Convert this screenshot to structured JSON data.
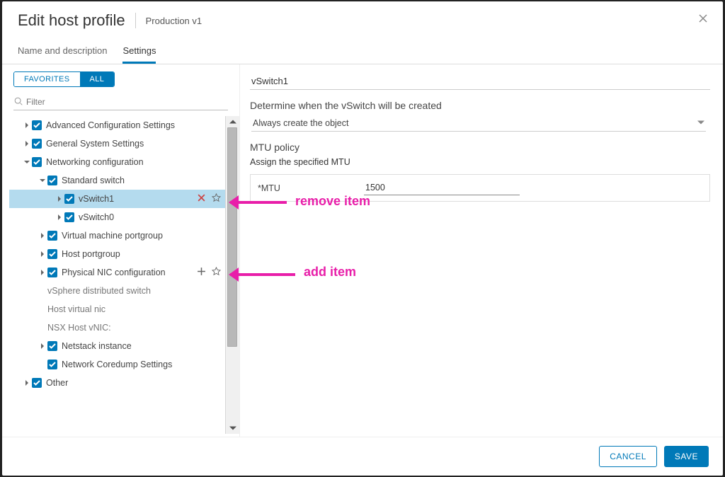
{
  "header": {
    "title": "Edit host profile",
    "subtitle": "Production v1"
  },
  "tabs": {
    "name_desc": "Name and description",
    "settings": "Settings"
  },
  "favtabs": {
    "fav": "FAVORITES",
    "all": "ALL"
  },
  "search": {
    "placeholder": "Filter"
  },
  "tree": {
    "adv": "Advanced Configuration Settings",
    "gen": "General System Settings",
    "net": "Networking configuration",
    "std": "Standard switch",
    "sw1": "vSwitch1",
    "sw0": "vSwitch0",
    "vmpg": "Virtual machine portgroup",
    "hpg": "Host portgroup",
    "pnic": "Physical NIC configuration",
    "vds": "vSphere distributed switch",
    "hvnic": "Host virtual nic",
    "nsx": "NSX Host vNIC:",
    "netstack": "Netstack instance",
    "coredump": "Network Coredump Settings",
    "other": "Other"
  },
  "right": {
    "name_value": "vSwitch1",
    "det_heading": "Determine when the vSwitch will be created",
    "det_value": "Always create the object",
    "mtu_heading": "MTU policy",
    "mtu_sub": "Assign the specified MTU",
    "mtu_label": "*MTU",
    "mtu_value": "1500"
  },
  "footer": {
    "cancel": "CANCEL",
    "save": "SAVE"
  },
  "anno": {
    "remove": "remove item",
    "add": "add item"
  }
}
